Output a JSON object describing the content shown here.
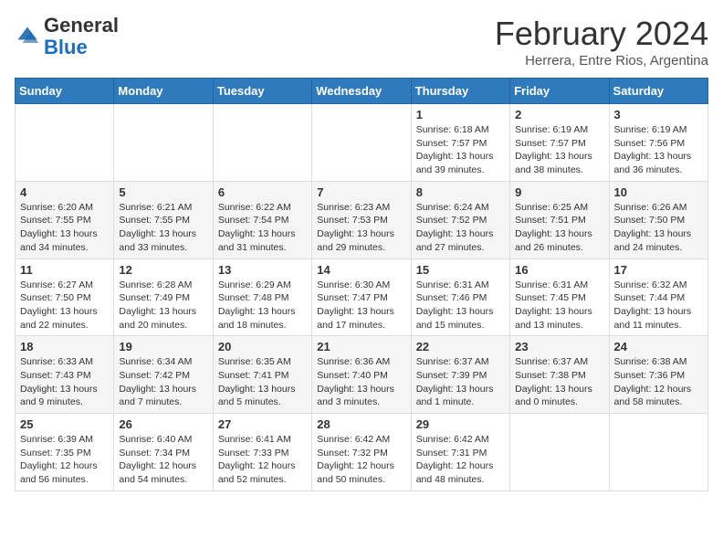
{
  "header": {
    "logo": {
      "general": "General",
      "blue": "Blue"
    },
    "title": "February 2024",
    "subtitle": "Herrera, Entre Rios, Argentina"
  },
  "calendar": {
    "days_of_week": [
      "Sunday",
      "Monday",
      "Tuesday",
      "Wednesday",
      "Thursday",
      "Friday",
      "Saturday"
    ],
    "weeks": [
      [
        {
          "day": "",
          "info": ""
        },
        {
          "day": "",
          "info": ""
        },
        {
          "day": "",
          "info": ""
        },
        {
          "day": "",
          "info": ""
        },
        {
          "day": "1",
          "info": "Sunrise: 6:18 AM\nSunset: 7:57 PM\nDaylight: 13 hours and 39 minutes."
        },
        {
          "day": "2",
          "info": "Sunrise: 6:19 AM\nSunset: 7:57 PM\nDaylight: 13 hours and 38 minutes."
        },
        {
          "day": "3",
          "info": "Sunrise: 6:19 AM\nSunset: 7:56 PM\nDaylight: 13 hours and 36 minutes."
        }
      ],
      [
        {
          "day": "4",
          "info": "Sunrise: 6:20 AM\nSunset: 7:55 PM\nDaylight: 13 hours and 34 minutes."
        },
        {
          "day": "5",
          "info": "Sunrise: 6:21 AM\nSunset: 7:55 PM\nDaylight: 13 hours and 33 minutes."
        },
        {
          "day": "6",
          "info": "Sunrise: 6:22 AM\nSunset: 7:54 PM\nDaylight: 13 hours and 31 minutes."
        },
        {
          "day": "7",
          "info": "Sunrise: 6:23 AM\nSunset: 7:53 PM\nDaylight: 13 hours and 29 minutes."
        },
        {
          "day": "8",
          "info": "Sunrise: 6:24 AM\nSunset: 7:52 PM\nDaylight: 13 hours and 27 minutes."
        },
        {
          "day": "9",
          "info": "Sunrise: 6:25 AM\nSunset: 7:51 PM\nDaylight: 13 hours and 26 minutes."
        },
        {
          "day": "10",
          "info": "Sunrise: 6:26 AM\nSunset: 7:50 PM\nDaylight: 13 hours and 24 minutes."
        }
      ],
      [
        {
          "day": "11",
          "info": "Sunrise: 6:27 AM\nSunset: 7:50 PM\nDaylight: 13 hours and 22 minutes."
        },
        {
          "day": "12",
          "info": "Sunrise: 6:28 AM\nSunset: 7:49 PM\nDaylight: 13 hours and 20 minutes."
        },
        {
          "day": "13",
          "info": "Sunrise: 6:29 AM\nSunset: 7:48 PM\nDaylight: 13 hours and 18 minutes."
        },
        {
          "day": "14",
          "info": "Sunrise: 6:30 AM\nSunset: 7:47 PM\nDaylight: 13 hours and 17 minutes."
        },
        {
          "day": "15",
          "info": "Sunrise: 6:31 AM\nSunset: 7:46 PM\nDaylight: 13 hours and 15 minutes."
        },
        {
          "day": "16",
          "info": "Sunrise: 6:31 AM\nSunset: 7:45 PM\nDaylight: 13 hours and 13 minutes."
        },
        {
          "day": "17",
          "info": "Sunrise: 6:32 AM\nSunset: 7:44 PM\nDaylight: 13 hours and 11 minutes."
        }
      ],
      [
        {
          "day": "18",
          "info": "Sunrise: 6:33 AM\nSunset: 7:43 PM\nDaylight: 13 hours and 9 minutes."
        },
        {
          "day": "19",
          "info": "Sunrise: 6:34 AM\nSunset: 7:42 PM\nDaylight: 13 hours and 7 minutes."
        },
        {
          "day": "20",
          "info": "Sunrise: 6:35 AM\nSunset: 7:41 PM\nDaylight: 13 hours and 5 minutes."
        },
        {
          "day": "21",
          "info": "Sunrise: 6:36 AM\nSunset: 7:40 PM\nDaylight: 13 hours and 3 minutes."
        },
        {
          "day": "22",
          "info": "Sunrise: 6:37 AM\nSunset: 7:39 PM\nDaylight: 13 hours and 1 minute."
        },
        {
          "day": "23",
          "info": "Sunrise: 6:37 AM\nSunset: 7:38 PM\nDaylight: 13 hours and 0 minutes."
        },
        {
          "day": "24",
          "info": "Sunrise: 6:38 AM\nSunset: 7:36 PM\nDaylight: 12 hours and 58 minutes."
        }
      ],
      [
        {
          "day": "25",
          "info": "Sunrise: 6:39 AM\nSunset: 7:35 PM\nDaylight: 12 hours and 56 minutes."
        },
        {
          "day": "26",
          "info": "Sunrise: 6:40 AM\nSunset: 7:34 PM\nDaylight: 12 hours and 54 minutes."
        },
        {
          "day": "27",
          "info": "Sunrise: 6:41 AM\nSunset: 7:33 PM\nDaylight: 12 hours and 52 minutes."
        },
        {
          "day": "28",
          "info": "Sunrise: 6:42 AM\nSunset: 7:32 PM\nDaylight: 12 hours and 50 minutes."
        },
        {
          "day": "29",
          "info": "Sunrise: 6:42 AM\nSunset: 7:31 PM\nDaylight: 12 hours and 48 minutes."
        },
        {
          "day": "",
          "info": ""
        },
        {
          "day": "",
          "info": ""
        }
      ]
    ]
  }
}
